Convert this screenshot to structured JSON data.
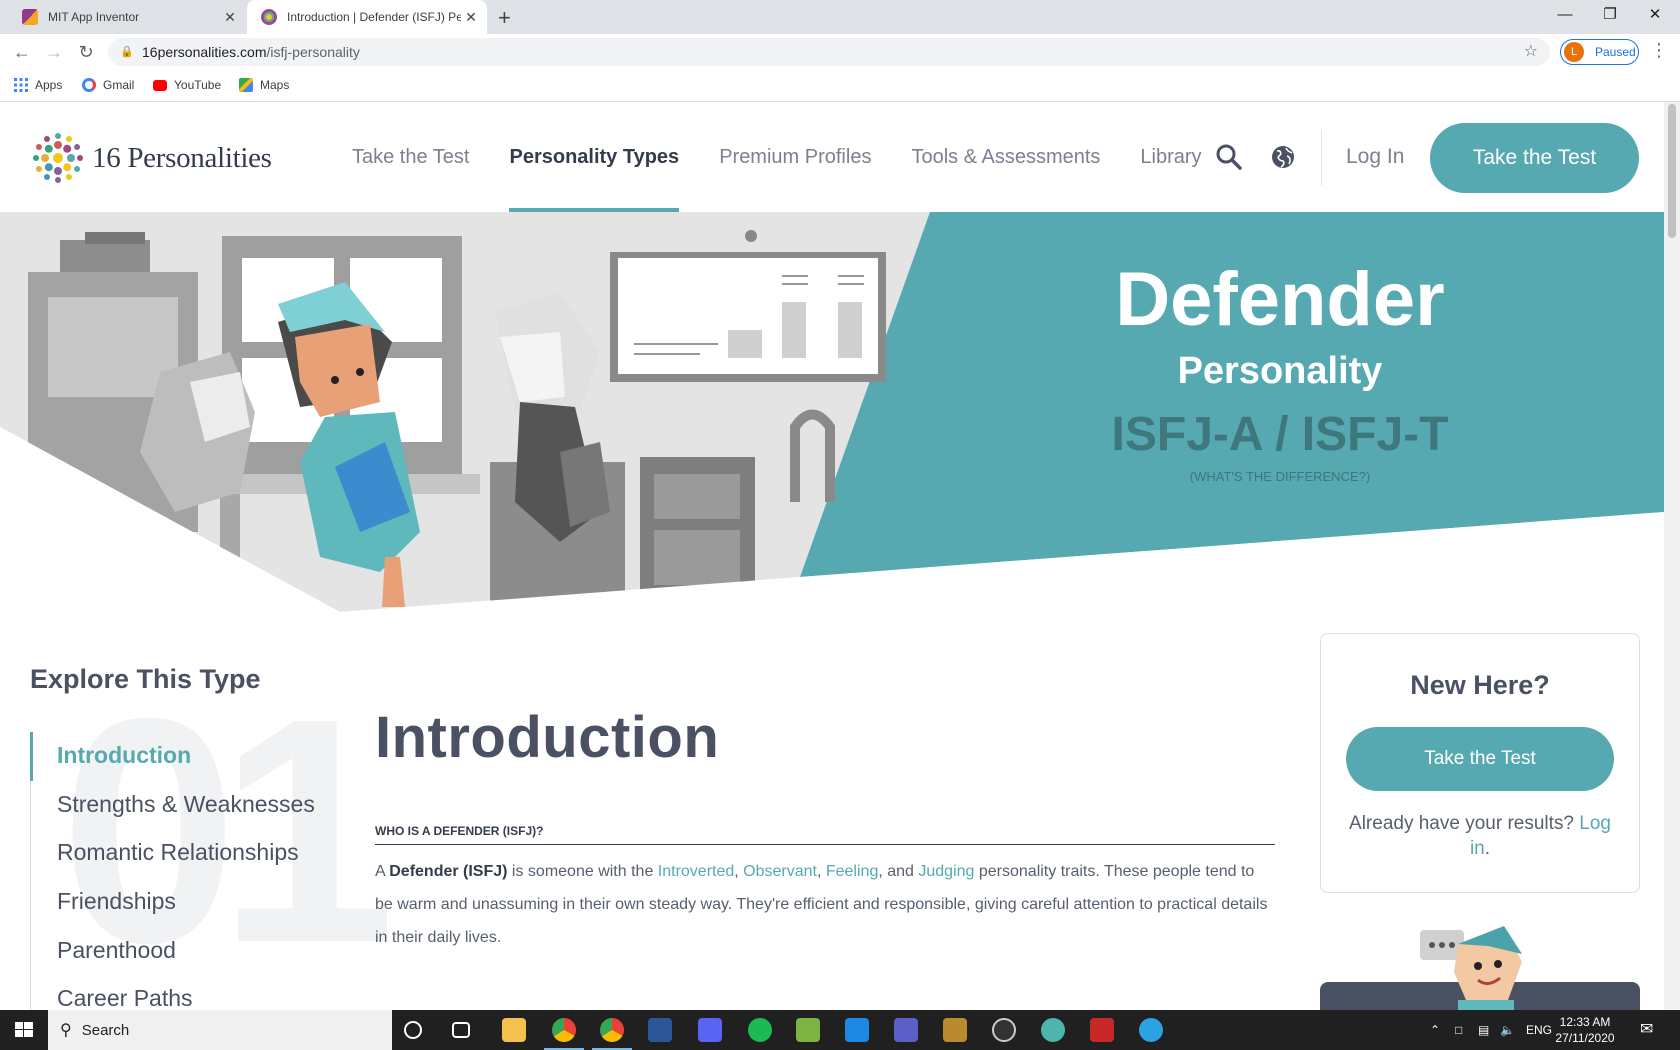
{
  "browser": {
    "tabs": [
      {
        "title": "MIT App Inventor",
        "active": false
      },
      {
        "title": "Introduction | Defender (ISFJ) Per",
        "active": true
      }
    ],
    "url_host": "16personalities.com",
    "url_path": "/isfj-personality",
    "profile_initial": "L",
    "profile_status": "Paused",
    "bookmarks": [
      "Apps",
      "Gmail",
      "YouTube",
      "Maps"
    ]
  },
  "site": {
    "logo_text": "16 Personalities",
    "nav": [
      "Take the Test",
      "Personality Types",
      "Premium Profiles",
      "Tools & Assessments",
      "Library"
    ],
    "active_nav": "Personality Types",
    "login_label": "Log In",
    "cta_label": "Take the Test",
    "accent_color": "#56a9b0"
  },
  "hero": {
    "title": "Defender",
    "subtitle": "Personality",
    "code": "ISFJ-A / ISFJ-T",
    "difference_link": "(WHAT'S THE DIFFERENCE?)"
  },
  "sidebar": {
    "heading": "Explore This Type",
    "big_number": "01",
    "items": [
      "Introduction",
      "Strengths & Weaknesses",
      "Romantic Relationships",
      "Friendships",
      "Parenthood",
      "Career Paths"
    ],
    "active_item": "Introduction"
  },
  "main": {
    "title": "Introduction",
    "subheading": "WHO IS A DEFENDER (ISFJ)?",
    "intro": {
      "p1": "A ",
      "bold": "Defender (ISFJ)",
      "p2": " is someone with the ",
      "trait1": "Introverted",
      "sep1": ", ",
      "trait2": "Observant",
      "sep2": ", ",
      "trait3": "Feeling",
      "sep3": ", and ",
      "trait4": "Judging",
      "p3": " personality traits. These people tend to be warm and unassuming in their own steady way. They're efficient and responsible, giving careful attention to practical details in their daily lives."
    }
  },
  "card": {
    "heading": "New Here?",
    "button": "Take the Test",
    "text": "Already have your results? ",
    "link": "Log in",
    "period": "."
  },
  "taskbar": {
    "search_label": "Search",
    "language": "ENG",
    "time": "12:33 AM",
    "date": "27/11/2020"
  }
}
